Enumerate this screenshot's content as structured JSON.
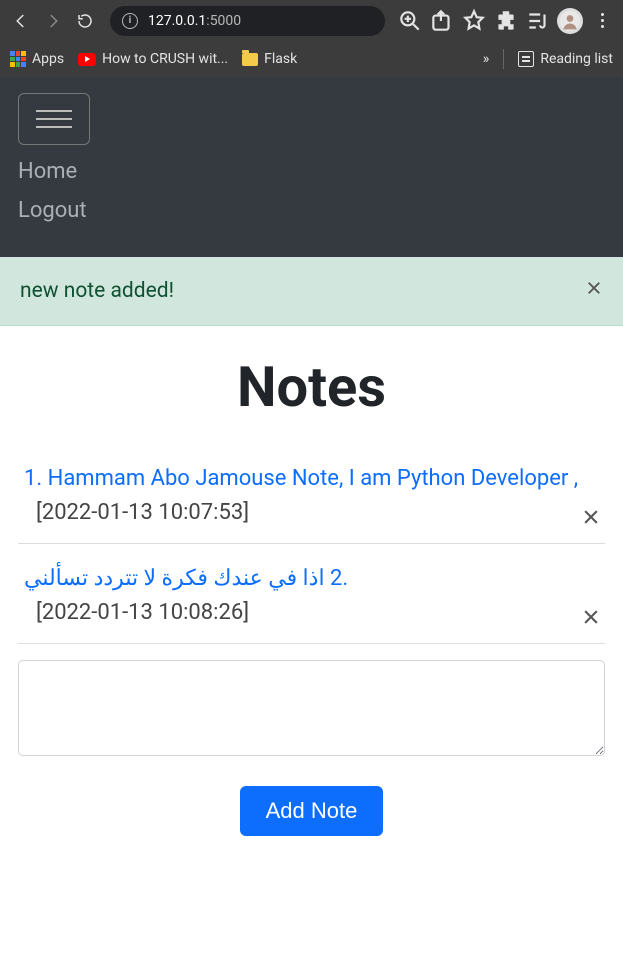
{
  "browser": {
    "url_host": "127.0.0.1",
    "url_path": ":5000",
    "bookmarks": {
      "apps": "Apps",
      "youtube": "How to CRUSH wit...",
      "flask": "Flask",
      "overflow": "»",
      "reading_list": "Reading list"
    }
  },
  "nav": {
    "home": "Home",
    "logout": "Logout"
  },
  "alert": {
    "message": "new note added!"
  },
  "page": {
    "title": "Notes",
    "add_button": "Add Note"
  },
  "notes": [
    {
      "index": "1.",
      "text": "Hammam Abo Jamouse Note, I am Python Developer ,",
      "date": "[2022-01-13 10:07:53]"
    },
    {
      "index": "2.",
      "text": "اذا في عندك فكرة لا تتردد تسألني",
      "date": "[2022-01-13 10:08:26]"
    }
  ],
  "input": {
    "value": ""
  }
}
